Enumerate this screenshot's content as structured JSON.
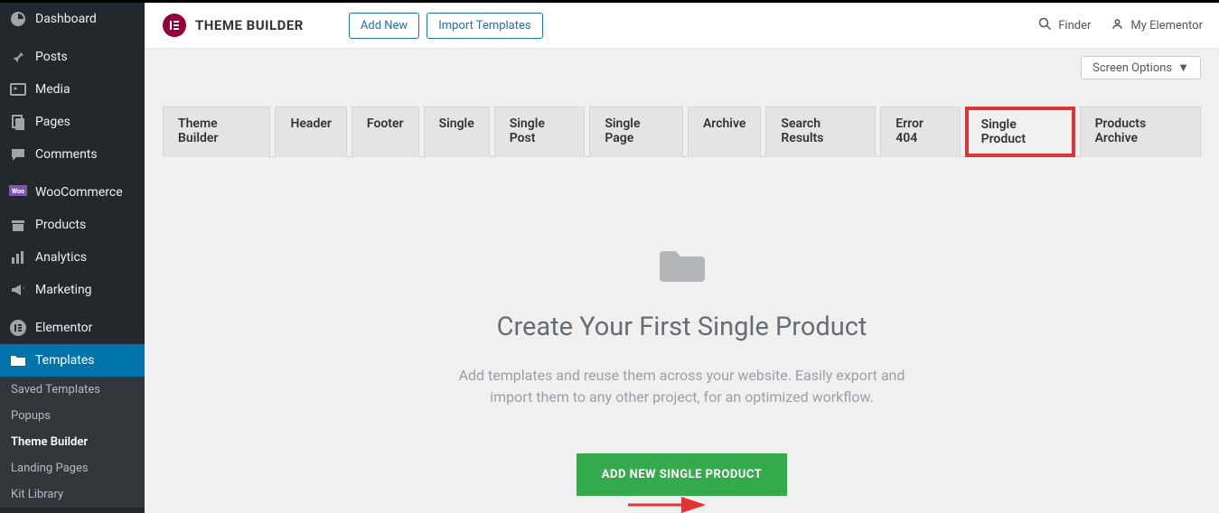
{
  "sidebar": {
    "items": [
      {
        "label": "Dashboard"
      },
      {
        "label": "Posts"
      },
      {
        "label": "Media"
      },
      {
        "label": "Pages"
      },
      {
        "label": "Comments"
      },
      {
        "label": "WooCommerce"
      },
      {
        "label": "Products"
      },
      {
        "label": "Analytics"
      },
      {
        "label": "Marketing"
      },
      {
        "label": "Elementor"
      },
      {
        "label": "Templates"
      }
    ],
    "submenu": [
      {
        "label": "Saved Templates"
      },
      {
        "label": "Popups"
      },
      {
        "label": "Theme Builder"
      },
      {
        "label": "Landing Pages"
      },
      {
        "label": "Kit Library"
      }
    ]
  },
  "topbar": {
    "logo": "E",
    "brand": "THEME BUILDER",
    "add_new": "Add New",
    "import": "Import Templates",
    "finder": "Finder",
    "my_elementor": "My Elementor"
  },
  "screen_options": "Screen Options",
  "tabs": [
    {
      "label": "Theme Builder"
    },
    {
      "label": "Header"
    },
    {
      "label": "Footer"
    },
    {
      "label": "Single"
    },
    {
      "label": "Single Post"
    },
    {
      "label": "Single Page"
    },
    {
      "label": "Archive"
    },
    {
      "label": "Search Results"
    },
    {
      "label": "Error 404"
    },
    {
      "label": "Single Product"
    },
    {
      "label": "Products Archive"
    }
  ],
  "empty": {
    "title": "Create Your First Single Product",
    "desc1": "Add templates and reuse them across your website. Easily export and",
    "desc2": "import them to any other project, for an optimized workflow.",
    "button": "ADD NEW SINGLE PRODUCT"
  }
}
